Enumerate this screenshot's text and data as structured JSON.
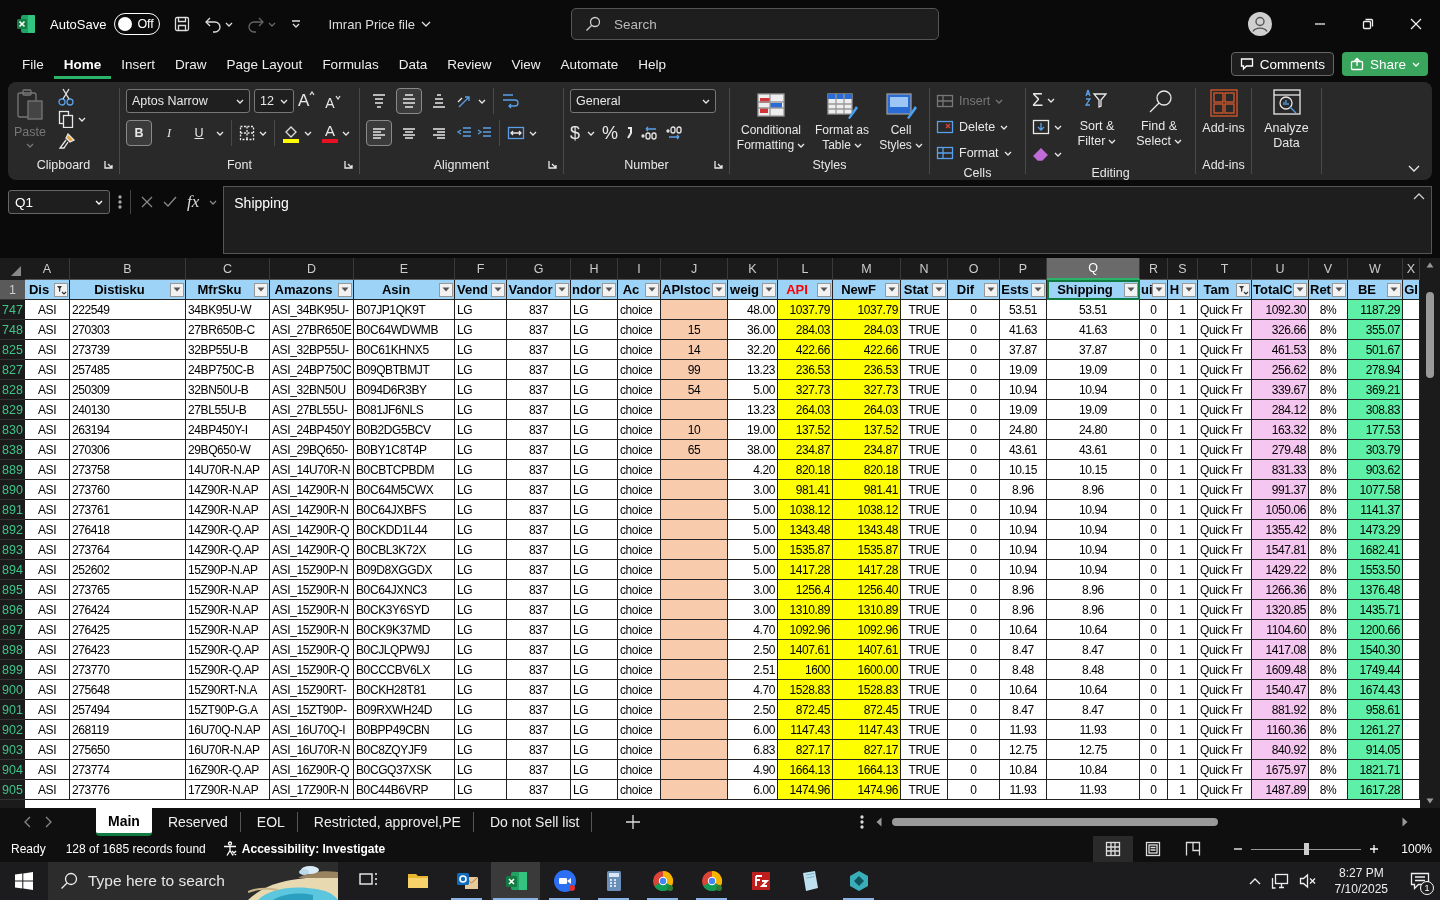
{
  "title_bar": {
    "autosave_label": "AutoSave",
    "autosave": {
      "on": false,
      "text": "Off"
    },
    "file_name": "Imran Price file",
    "search_placeholder": "Search"
  },
  "menu": {
    "tabs": [
      {
        "label": "File",
        "selected": false
      },
      {
        "label": "Home",
        "selected": true
      },
      {
        "label": "Insert",
        "selected": false
      },
      {
        "label": "Draw",
        "selected": false
      },
      {
        "label": "Page Layout",
        "selected": false
      },
      {
        "label": "Formulas",
        "selected": false
      },
      {
        "label": "Data",
        "selected": false
      },
      {
        "label": "Review",
        "selected": false
      },
      {
        "label": "View",
        "selected": false
      },
      {
        "label": "Automate",
        "selected": false
      },
      {
        "label": "Help",
        "selected": false
      }
    ],
    "comments": "Comments",
    "share": "Share"
  },
  "ribbon": {
    "clipboard": {
      "label": "Clipboard",
      "paste": {
        "text": "Paste",
        "disabled": true
      }
    },
    "font": {
      "label": "Font",
      "name": "Aptos Narrow",
      "size": "12",
      "grow": "A",
      "shrink": "A",
      "color_letter": "A",
      "styles": [
        {
          "text": "B",
          "selected": true
        },
        {
          "text": "I",
          "selected": false
        },
        {
          "text": "U",
          "selected": false
        }
      ]
    },
    "alignment": {
      "label": "Alignment",
      "vertical": [
        {
          "kind": "top",
          "selected": false
        },
        {
          "kind": "middle",
          "selected": true
        },
        {
          "kind": "bottom",
          "selected": false
        }
      ],
      "horizontal": [
        {
          "kind": "left",
          "selected": true
        },
        {
          "kind": "center",
          "selected": false
        },
        {
          "kind": "right",
          "selected": false
        }
      ]
    },
    "number": {
      "label": "Number",
      "format": "General",
      "currency": "$",
      "percent": "%"
    },
    "styles": {
      "label": "Styles",
      "buttons": [
        {
          "kind": "conditional",
          "text": "Conditional Formatting"
        },
        {
          "kind": "table",
          "text": "Format as Table"
        },
        {
          "kind": "cell",
          "text": "Cell Styles"
        }
      ]
    },
    "cells": {
      "label": "Cells",
      "buttons": [
        {
          "kind": "insert",
          "text": "Insert",
          "disabled": true
        },
        {
          "kind": "delete",
          "text": "Delete",
          "disabled": false
        },
        {
          "kind": "format",
          "text": "Format",
          "disabled": false
        }
      ]
    },
    "editing": {
      "label": "Editing",
      "autosum": "Σ",
      "buttons": [
        {
          "kind": "sort",
          "text": "Sort & Filter"
        },
        {
          "kind": "find",
          "text": "Find & Select"
        }
      ]
    },
    "addins": {
      "label": "Add-ins",
      "button": "Add-ins"
    },
    "analyze": {
      "button": "Analyze Data"
    }
  },
  "formula_bar": {
    "name_box": "Q1",
    "fx": "fx",
    "value": "Shipping"
  },
  "sheet": {
    "header_row": "1",
    "columns": [
      {
        "letter": "A",
        "header": {
          "text": "Dis"
        },
        "filtered": true,
        "selected": false
      },
      {
        "letter": "B",
        "header": {
          "text": "Distisku"
        },
        "filtered": false,
        "selected": false
      },
      {
        "letter": "C",
        "header": {
          "text": "MfrSku"
        },
        "filtered": false,
        "selected": false
      },
      {
        "letter": "D",
        "header": {
          "text": "Amazons"
        },
        "filtered": false,
        "selected": false
      },
      {
        "letter": "E",
        "header": {
          "text": "Asin"
        },
        "filtered": false,
        "selected": false
      },
      {
        "letter": "F",
        "header": {
          "text": "Vend"
        },
        "filtered": false,
        "selected": false
      },
      {
        "letter": "G",
        "header": {
          "text": "Vandor"
        },
        "filtered": false,
        "selected": false
      },
      {
        "letter": "H",
        "header": {
          "text": "ndor"
        },
        "filtered": false,
        "selected": false
      },
      {
        "letter": "I",
        "header": {
          "text": "Ac"
        },
        "filtered": false,
        "selected": false
      },
      {
        "letter": "J",
        "header": {
          "text": "APIstoc"
        },
        "filtered": false,
        "selected": false,
        "color": "#f8cbad"
      },
      {
        "letter": "K",
        "header": {
          "text": "weig"
        },
        "filtered": false,
        "selected": false
      },
      {
        "letter": "L",
        "header": {
          "text": "API",
          "color": "#ff0000"
        },
        "filtered": false,
        "selected": false,
        "color": "#ffff00"
      },
      {
        "letter": "M",
        "header": {
          "text": "NewF"
        },
        "filtered": false,
        "selected": false,
        "color": "#ffff00"
      },
      {
        "letter": "N",
        "header": {
          "text": "Stat"
        },
        "filtered": false,
        "selected": false
      },
      {
        "letter": "O",
        "header": {
          "text": "Dif"
        },
        "filtered": false,
        "selected": false
      },
      {
        "letter": "P",
        "header": {
          "text": "Ests"
        },
        "filtered": false,
        "selected": false
      },
      {
        "letter": "Q",
        "header": {
          "text": "Shipping"
        },
        "filtered": false,
        "selected": true
      },
      {
        "letter": "R",
        "header": {
          "text": "ui"
        },
        "filtered": false,
        "selected": false
      },
      {
        "letter": "S",
        "header": {
          "text": "H"
        },
        "filtered": false,
        "selected": false
      },
      {
        "letter": "T",
        "header": {
          "text": "Tam"
        },
        "filtered": true,
        "selected": false
      },
      {
        "letter": "U",
        "header": {
          "text": "TotalC"
        },
        "filtered": false,
        "selected": false,
        "color": "#f5c6ef"
      },
      {
        "letter": "V",
        "header": {
          "text": "Ret"
        },
        "filtered": false,
        "selected": false
      },
      {
        "letter": "W",
        "header": {
          "text": "BE"
        },
        "filtered": false,
        "selected": false,
        "color": "#5ff0a8"
      },
      {
        "letter": "X",
        "header": {
          "text": "GI"
        },
        "selected": false
      }
    ],
    "rows": [
      {
        "number": "747",
        "cells": [
          "ASI",
          "222549",
          "34BK95U-W",
          "ASI_34BK95U-",
          "B07JP1QK9T",
          "LG",
          "837",
          "LG",
          "choice",
          null,
          "48.00",
          "1037.79",
          "1037.79",
          "TRUE",
          "0",
          "53.51",
          "53.51",
          "0",
          "1",
          "Quick Fr",
          "1092.30",
          "8%",
          "1187.29"
        ]
      },
      {
        "number": "748",
        "cells": [
          "ASI",
          "270303",
          "27BR650B-C",
          "ASI_27BR650E",
          "B0C64WDWMB",
          "LG",
          "837",
          "LG",
          "choice",
          "15",
          "36.00",
          "284.03",
          "284.03",
          "TRUE",
          "0",
          "41.63",
          "41.63",
          "0",
          "1",
          "Quick Fr",
          "326.66",
          "8%",
          "355.07"
        ]
      },
      {
        "number": "825",
        "cells": [
          "ASI",
          "273739",
          "32BP55U-B",
          "ASI_32BP55U-",
          "B0C61KHNX5",
          "LG",
          "837",
          "LG",
          "choice",
          "14",
          "32.20",
          "422.66",
          "422.66",
          "TRUE",
          "0",
          "37.87",
          "37.87",
          "0",
          "1",
          "Quick Fr",
          "461.53",
          "8%",
          "501.67"
        ]
      },
      {
        "number": "827",
        "cells": [
          "ASI",
          "257485",
          "24BP750C-B",
          "ASI_24BP750C",
          "B09QBTBMJT",
          "LG",
          "837",
          "LG",
          "choice",
          "99",
          "13.23",
          "236.53",
          "236.53",
          "TRUE",
          "0",
          "19.09",
          "19.09",
          "0",
          "1",
          "Quick Fr",
          "256.62",
          "8%",
          "278.94"
        ]
      },
      {
        "number": "828",
        "cells": [
          "ASI",
          "250309",
          "32BN50U-B",
          "ASI_32BN50U",
          "B094D6R3BY",
          "LG",
          "837",
          "LG",
          "choice",
          "54",
          "5.00",
          "327.73",
          "327.73",
          "TRUE",
          "0",
          "10.94",
          "10.94",
          "0",
          "1",
          "Quick Fr",
          "339.67",
          "8%",
          "369.21"
        ]
      },
      {
        "number": "829",
        "cells": [
          "ASI",
          "240130",
          "27BL55U-B",
          "ASI_27BL55U-",
          "B081JF6NLS",
          "LG",
          "837",
          "LG",
          "choice",
          null,
          "13.23",
          "264.03",
          "264.03",
          "TRUE",
          "0",
          "19.09",
          "19.09",
          "0",
          "1",
          "Quick Fr",
          "284.12",
          "8%",
          "308.83"
        ]
      },
      {
        "number": "830",
        "cells": [
          "ASI",
          "263194",
          "24BP450Y-I",
          "ASI_24BP450Y",
          "B0B2DG5BCV",
          "LG",
          "837",
          "LG",
          "choice",
          "10",
          "19.00",
          "137.52",
          "137.52",
          "TRUE",
          "0",
          "24.80",
          "24.80",
          "0",
          "1",
          "Quick Fr",
          "163.32",
          "8%",
          "177.53"
        ]
      },
      {
        "number": "838",
        "cells": [
          "ASI",
          "270306",
          "29BQ650-W",
          "ASI_29BQ650-",
          "B0BY1C8T4P",
          "LG",
          "837",
          "LG",
          "choice",
          "65",
          "38.00",
          "234.87",
          "234.87",
          "TRUE",
          "0",
          "43.61",
          "43.61",
          "0",
          "1",
          "Quick Fr",
          "279.48",
          "8%",
          "303.79"
        ]
      },
      {
        "number": "889",
        "cells": [
          "ASI",
          "273758",
          "14U70R-N.AP",
          "ASI_14U70R-N",
          "B0CBTCPBDM",
          "LG",
          "837",
          "LG",
          "choice",
          null,
          "4.20",
          "820.18",
          "820.18",
          "TRUE",
          "0",
          "10.15",
          "10.15",
          "0",
          "1",
          "Quick Fr",
          "831.33",
          "8%",
          "903.62"
        ]
      },
      {
        "number": "890",
        "cells": [
          "ASI",
          "273760",
          "14Z90R-N.AP",
          "ASI_14Z90R-N",
          "B0C64M5CWX",
          "LG",
          "837",
          "LG",
          "choice",
          null,
          "3.00",
          "981.41",
          "981.41",
          "TRUE",
          "0",
          "8.96",
          "8.96",
          "0",
          "1",
          "Quick Fr",
          "991.37",
          "8%",
          "1077.58"
        ]
      },
      {
        "number": "891",
        "cells": [
          "ASI",
          "273761",
          "14Z90R-N.AP",
          "ASI_14Z90R-N",
          "B0C64JXBFS",
          "LG",
          "837",
          "LG",
          "choice",
          null,
          "5.00",
          "1038.12",
          "1038.12",
          "TRUE",
          "0",
          "10.94",
          "10.94",
          "0",
          "1",
          "Quick Fr",
          "1050.06",
          "8%",
          "1141.37"
        ]
      },
      {
        "number": "892",
        "cells": [
          "ASI",
          "276418",
          "14Z90R-Q.AP",
          "ASI_14Z90R-Q",
          "B0CKDD1L44",
          "LG",
          "837",
          "LG",
          "choice",
          null,
          "5.00",
          "1343.48",
          "1343.48",
          "TRUE",
          "0",
          "10.94",
          "10.94",
          "0",
          "1",
          "Quick Fr",
          "1355.42",
          "8%",
          "1473.29"
        ]
      },
      {
        "number": "893",
        "cells": [
          "ASI",
          "273764",
          "14Z90R-Q.AP",
          "ASI_14Z90R-Q",
          "B0CBL3K72X",
          "LG",
          "837",
          "LG",
          "choice",
          null,
          "5.00",
          "1535.87",
          "1535.87",
          "TRUE",
          "0",
          "10.94",
          "10.94",
          "0",
          "1",
          "Quick Fr",
          "1547.81",
          "8%",
          "1682.41"
        ]
      },
      {
        "number": "894",
        "cells": [
          "ASI",
          "252602",
          "15Z90P-N.AP",
          "ASI_15Z90P-N",
          "B09D8XGGDX",
          "LG",
          "837",
          "LG",
          "choice",
          null,
          "5.00",
          "1417.28",
          "1417.28",
          "TRUE",
          "0",
          "10.94",
          "10.94",
          "0",
          "1",
          "Quick Fr",
          "1429.22",
          "8%",
          "1553.50"
        ]
      },
      {
        "number": "895",
        "cells": [
          "ASI",
          "273765",
          "15Z90R-N.AP",
          "ASI_15Z90R-N",
          "B0C64JXNC3",
          "LG",
          "837",
          "LG",
          "choice",
          null,
          "3.00",
          "1256.4",
          "1256.40",
          "TRUE",
          "0",
          "8.96",
          "8.96",
          "0",
          "1",
          "Quick Fr",
          "1266.36",
          "8%",
          "1376.48"
        ]
      },
      {
        "number": "896",
        "cells": [
          "ASI",
          "276424",
          "15Z90R-N.AP",
          "ASI_15Z90R-N",
          "B0CK3Y6SYD",
          "LG",
          "837",
          "LG",
          "choice",
          null,
          "3.00",
          "1310.89",
          "1310.89",
          "TRUE",
          "0",
          "8.96",
          "8.96",
          "0",
          "1",
          "Quick Fr",
          "1320.85",
          "8%",
          "1435.71"
        ]
      },
      {
        "number": "897",
        "cells": [
          "ASI",
          "276425",
          "15Z90R-N.AP",
          "ASI_15Z90R-N",
          "B0CK9K37MD",
          "LG",
          "837",
          "LG",
          "choice",
          null,
          "4.70",
          "1092.96",
          "1092.96",
          "TRUE",
          "0",
          "10.64",
          "10.64",
          "0",
          "1",
          "Quick Fr",
          "1104.60",
          "8%",
          "1200.66"
        ]
      },
      {
        "number": "898",
        "cells": [
          "ASI",
          "276423",
          "15Z90R-Q.AP",
          "ASI_15Z90R-Q",
          "B0CJLQPW9J",
          "LG",
          "837",
          "LG",
          "choice",
          null,
          "2.50",
          "1407.61",
          "1407.61",
          "TRUE",
          "0",
          "8.47",
          "8.47",
          "0",
          "1",
          "Quick Fr",
          "1417.08",
          "8%",
          "1540.30"
        ]
      },
      {
        "number": "899",
        "cells": [
          "ASI",
          "273770",
          "15Z90R-Q.AP",
          "ASI_15Z90R-Q",
          "B0CCCBV6LX",
          "LG",
          "837",
          "LG",
          "choice",
          null,
          "2.51",
          "1600",
          "1600.00",
          "TRUE",
          "0",
          "8.48",
          "8.48",
          "0",
          "1",
          "Quick Fr",
          "1609.48",
          "8%",
          "1749.44"
        ]
      },
      {
        "number": "900",
        "cells": [
          "ASI",
          "275648",
          "15Z90RT-N.A",
          "ASI_15Z90RT-",
          "B0CKH28T81",
          "LG",
          "837",
          "LG",
          "choice",
          null,
          "4.70",
          "1528.83",
          "1528.83",
          "TRUE",
          "0",
          "10.64",
          "10.64",
          "0",
          "1",
          "Quick Fr",
          "1540.47",
          "8%",
          "1674.43"
        ]
      },
      {
        "number": "901",
        "cells": [
          "ASI",
          "257494",
          "15ZT90P-G.A",
          "ASI_15ZT90P-",
          "B09RXWH24D",
          "LG",
          "837",
          "LG",
          "choice",
          null,
          "2.50",
          "872.45",
          "872.45",
          "TRUE",
          "0",
          "8.47",
          "8.47",
          "0",
          "1",
          "Quick Fr",
          "881.92",
          "8%",
          "958.61"
        ]
      },
      {
        "number": "902",
        "cells": [
          "ASI",
          "268119",
          "16U70Q-N.AP",
          "ASI_16U70Q-I",
          "B0BPP49CBN",
          "LG",
          "837",
          "LG",
          "choice",
          null,
          "6.00",
          "1147.43",
          "1147.43",
          "TRUE",
          "0",
          "11.93",
          "11.93",
          "0",
          "1",
          "Quick Fr",
          "1160.36",
          "8%",
          "1261.27"
        ]
      },
      {
        "number": "903",
        "cells": [
          "ASI",
          "275650",
          "16U70R-N.AP",
          "ASI_16U70R-N",
          "B0C8ZQYJF9",
          "LG",
          "837",
          "LG",
          "choice",
          null,
          "6.83",
          "827.17",
          "827.17",
          "TRUE",
          "0",
          "12.75",
          "12.75",
          "0",
          "1",
          "Quick Fr",
          "840.92",
          "8%",
          "914.05"
        ]
      },
      {
        "number": "904",
        "cells": [
          "ASI",
          "273774",
          "16Z90R-Q.AP",
          "ASI_16Z90R-Q",
          "B0CGQ37XSK",
          "LG",
          "837",
          "LG",
          "choice",
          null,
          "4.90",
          "1664.13",
          "1664.13",
          "TRUE",
          "0",
          "10.84",
          "10.84",
          "0",
          "1",
          "Quick Fr",
          "1675.97",
          "8%",
          "1821.71"
        ]
      },
      {
        "number": "905",
        "cells": [
          "ASI",
          "273776",
          "17Z90R-N.AP",
          "ASI_17Z90R-N",
          "B0C44B6VRP",
          "LG",
          "837",
          "LG",
          "choice",
          null,
          "6.00",
          "1474.96",
          "1474.96",
          "TRUE",
          "0",
          "11.93",
          "11.93",
          "0",
          "1",
          "Quick Fr",
          "1487.89",
          "8%",
          "1617.28"
        ]
      }
    ]
  },
  "sheet_tabs": [
    {
      "label": "Main",
      "selected": true
    },
    {
      "label": "Reserved",
      "selected": false
    },
    {
      "label": "EOL",
      "selected": false
    },
    {
      "label": "Restricted, approvel,PE",
      "selected": false
    },
    {
      "label": "Do not Sell list",
      "selected": false
    }
  ],
  "status_bar": {
    "mode": "Ready",
    "records": "128 of 1685 records found",
    "accessibility": "Accessibility: Investigate",
    "views": [
      {
        "kind": "normal",
        "selected": true
      },
      {
        "kind": "page-layout",
        "selected": false
      },
      {
        "kind": "page-break",
        "selected": false
      }
    ],
    "zoom": {
      "level": 0.5,
      "reading": "100%"
    }
  },
  "taskbar": {
    "search_placeholder": "Type here to search",
    "apps": [
      {
        "kind": "task-view",
        "running": false,
        "selected": false
      },
      {
        "kind": "folder",
        "running": false,
        "selected": false
      },
      {
        "kind": "mail",
        "running": true,
        "selected": false
      },
      {
        "kind": "spreadsheet",
        "running": true,
        "selected": true
      },
      {
        "kind": "video",
        "running": true,
        "selected": false
      },
      {
        "kind": "calculator",
        "running": true,
        "selected": false
      },
      {
        "kind": "browser",
        "running": true,
        "selected": false
      },
      {
        "kind": "browser",
        "running": true,
        "selected": false
      },
      {
        "kind": "ftp",
        "running": false,
        "selected": false
      },
      {
        "kind": "sheet",
        "running": false,
        "selected": false
      },
      {
        "kind": "diamond",
        "running": true,
        "selected": false
      }
    ],
    "time": "8:27 PM",
    "date": "7/10/2025",
    "notifications": "1"
  }
}
